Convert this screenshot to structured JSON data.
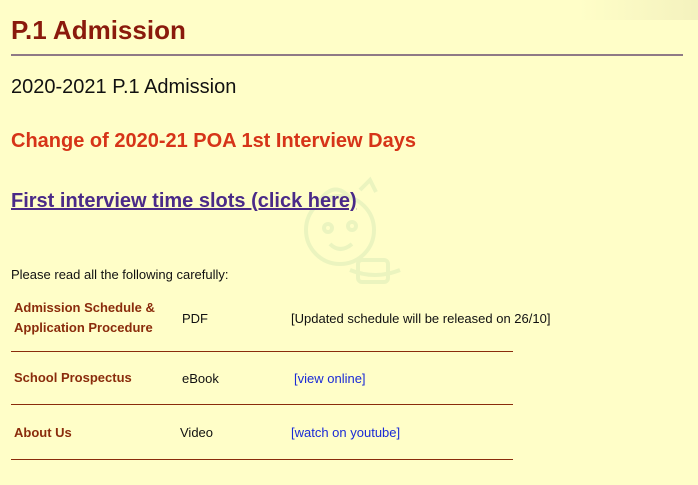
{
  "page": {
    "title": "P.1 Admission",
    "subtitle": "2020-2021 P.1 Admission",
    "notice": "Change of 2020-21 POA 1st Interview Days",
    "slots_link": "First interview time slots (click here)",
    "instruction": "Please read all the following carefully:"
  },
  "rows": [
    {
      "name_line1": "Admission Schedule &",
      "name_line2": "Application Procedure",
      "type": "PDF",
      "action": "[Updated schedule will be released on 26/10]"
    },
    {
      "name_line1": "School Prospectus",
      "type": "eBook",
      "action": "[view online]"
    },
    {
      "name_line1": "About Us",
      "type": "Video",
      "action": "[watch on youtube]"
    }
  ],
  "colors": {
    "background": "#fffec8",
    "title": "#8a1a0c",
    "notice": "#d63418",
    "link": "#1a2ad6",
    "visited_link": "#4a2a88"
  },
  "watermark_icon": "cartoon-baby-watermark-icon"
}
